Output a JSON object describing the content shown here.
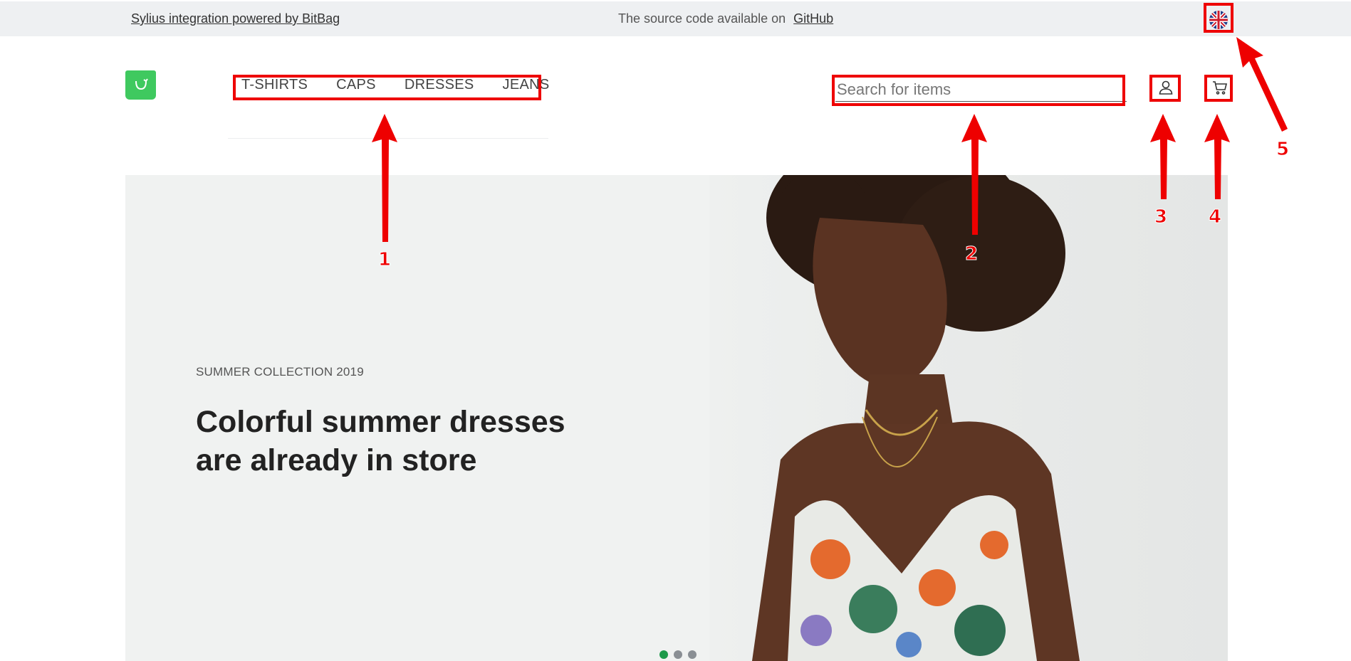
{
  "topbar": {
    "integration_link": "Sylius integration powered by BitBag",
    "source_text": "The source code available on",
    "github_link": "GitHub",
    "language_icon": "uk-flag-icon"
  },
  "header": {
    "logo_icon": "shopping-bag-logo-icon",
    "nav_items": [
      {
        "label": "T-SHIRTS"
      },
      {
        "label": "CAPS"
      },
      {
        "label": "DRESSES"
      },
      {
        "label": "JEANS"
      }
    ],
    "search": {
      "placeholder": "Search for items",
      "value": ""
    },
    "user_icon": "user-icon",
    "cart_icon": "cart-icon"
  },
  "hero": {
    "kicker": "SUMMER COLLECTION 2019",
    "title": "Colorful summer dresses are already in store",
    "carousel_dots": 3,
    "active_dot": 1
  },
  "annotations": {
    "labels": [
      "1",
      "2",
      "3",
      "4",
      "5"
    ]
  },
  "colors": {
    "accent_green": "#3fc95f",
    "callout_red": "#ee0000",
    "topbar_bg": "#eef0f2"
  }
}
